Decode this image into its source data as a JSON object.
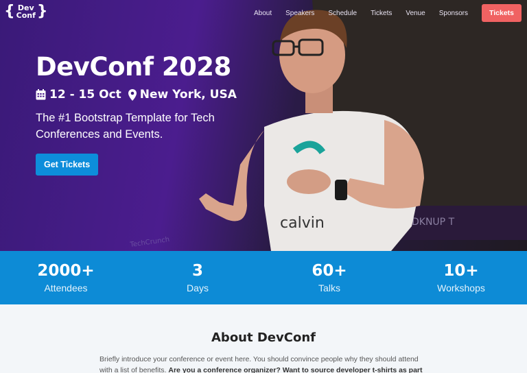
{
  "logo": {
    "brace_left": "{",
    "line1": "Dev",
    "line2": "Conf",
    "brace_right": "}"
  },
  "nav": {
    "links": [
      "About",
      "Speakers",
      "Schedule",
      "Tickets",
      "Venue",
      "Sponsors"
    ],
    "cta_label": "Tickets"
  },
  "hero": {
    "title": "DevConf 2028",
    "dates": "12 - 15 Oct",
    "location": "New York, USA",
    "tagline": "The #1 Bootstrap Template for Tech Conferences and Events.",
    "button_label": "Get Tickets",
    "shirt_text": "calvin"
  },
  "stats": [
    {
      "value": "2000+",
      "label": "Attendees"
    },
    {
      "value": "3",
      "label": "Days"
    },
    {
      "value": "60+",
      "label": "Talks"
    },
    {
      "value": "10+",
      "label": "Workshops"
    }
  ],
  "about": {
    "title": "About DevConf",
    "text_plain": "Briefly introduce your conference or event here. You should convince people why they should attend with a list of benefits.",
    "text_bold": "Are you a conference organizer? Want to source developer t-shirts as part of"
  },
  "colors": {
    "accent_blue": "#0d8bd6",
    "cta_red": "#f06262",
    "hero_purple": "#4b1d8e"
  }
}
